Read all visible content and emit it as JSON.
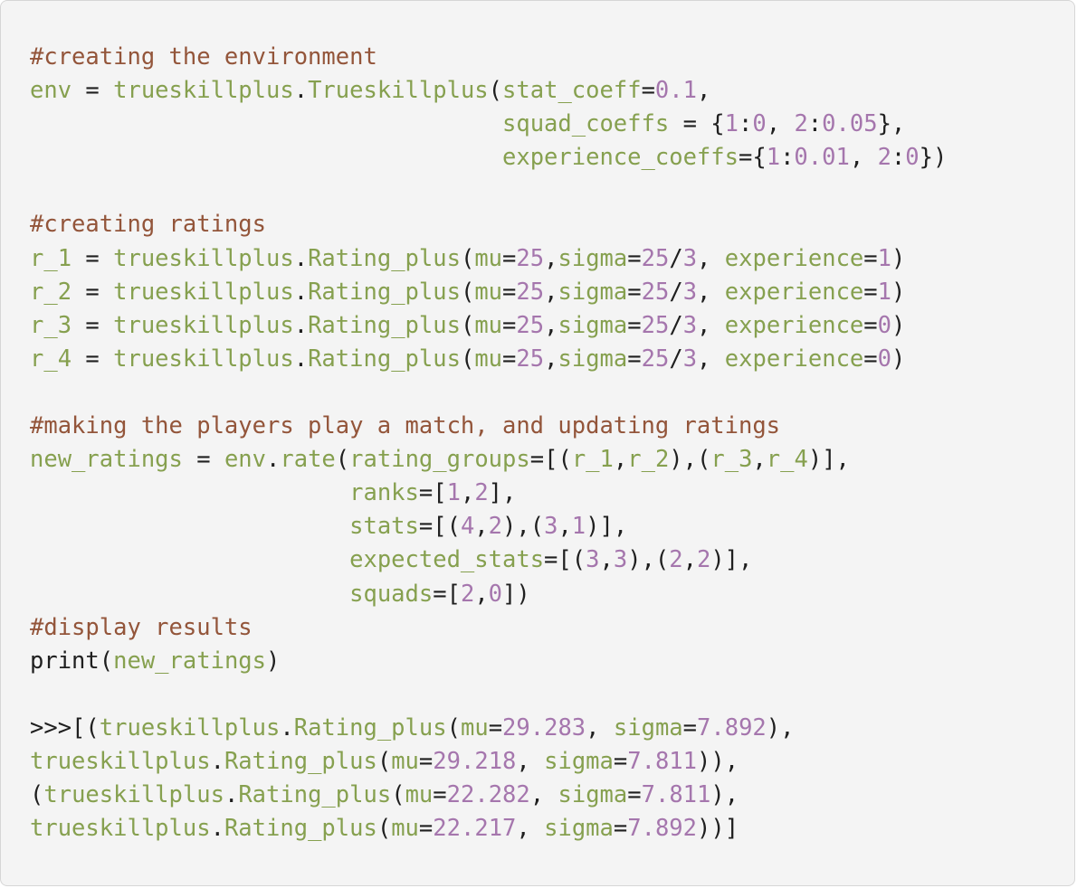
{
  "colors": {
    "background": "#f4f4f4",
    "comment": "#93553a",
    "name": "#86a04f",
    "number": "#a576ad",
    "operator": "#1f1f1f"
  },
  "code_lines": [
    [
      [
        "cmt",
        "#creating the environment"
      ]
    ],
    [
      [
        "nm",
        "env"
      ],
      [
        "op",
        " = "
      ],
      [
        "nm",
        "trueskillplus"
      ],
      [
        "op",
        "."
      ],
      [
        "nm",
        "Trueskillplus"
      ],
      [
        "op",
        "("
      ],
      [
        "nm",
        "stat_coeff"
      ],
      [
        "op",
        "="
      ],
      [
        "num",
        "0.1"
      ],
      [
        "op",
        ","
      ]
    ],
    [
      [
        "op",
        "                                  "
      ],
      [
        "nm",
        "squad_coeffs"
      ],
      [
        "op",
        " = {"
      ],
      [
        "num",
        "1"
      ],
      [
        "op",
        ":"
      ],
      [
        "num",
        "0"
      ],
      [
        "op",
        ", "
      ],
      [
        "num",
        "2"
      ],
      [
        "op",
        ":"
      ],
      [
        "num",
        "0.05"
      ],
      [
        "op",
        "},"
      ]
    ],
    [
      [
        "op",
        "                                  "
      ],
      [
        "nm",
        "experience_coeffs"
      ],
      [
        "op",
        "={"
      ],
      [
        "num",
        "1"
      ],
      [
        "op",
        ":"
      ],
      [
        "num",
        "0.01"
      ],
      [
        "op",
        ", "
      ],
      [
        "num",
        "2"
      ],
      [
        "op",
        ":"
      ],
      [
        "num",
        "0"
      ],
      [
        "op",
        "})"
      ]
    ],
    [],
    [
      [
        "cmt",
        "#creating ratings"
      ]
    ],
    [
      [
        "nm",
        "r_1"
      ],
      [
        "op",
        " = "
      ],
      [
        "nm",
        "trueskillplus"
      ],
      [
        "op",
        "."
      ],
      [
        "nm",
        "Rating_plus"
      ],
      [
        "op",
        "("
      ],
      [
        "nm",
        "mu"
      ],
      [
        "op",
        "="
      ],
      [
        "num",
        "25"
      ],
      [
        "op",
        ","
      ],
      [
        "nm",
        "sigma"
      ],
      [
        "op",
        "="
      ],
      [
        "num",
        "25"
      ],
      [
        "op",
        "/"
      ],
      [
        "num",
        "3"
      ],
      [
        "op",
        ", "
      ],
      [
        "nm",
        "experience"
      ],
      [
        "op",
        "="
      ],
      [
        "num",
        "1"
      ],
      [
        "op",
        ")"
      ]
    ],
    [
      [
        "nm",
        "r_2"
      ],
      [
        "op",
        " = "
      ],
      [
        "nm",
        "trueskillplus"
      ],
      [
        "op",
        "."
      ],
      [
        "nm",
        "Rating_plus"
      ],
      [
        "op",
        "("
      ],
      [
        "nm",
        "mu"
      ],
      [
        "op",
        "="
      ],
      [
        "num",
        "25"
      ],
      [
        "op",
        ","
      ],
      [
        "nm",
        "sigma"
      ],
      [
        "op",
        "="
      ],
      [
        "num",
        "25"
      ],
      [
        "op",
        "/"
      ],
      [
        "num",
        "3"
      ],
      [
        "op",
        ", "
      ],
      [
        "nm",
        "experience"
      ],
      [
        "op",
        "="
      ],
      [
        "num",
        "1"
      ],
      [
        "op",
        ")"
      ]
    ],
    [
      [
        "nm",
        "r_3"
      ],
      [
        "op",
        " = "
      ],
      [
        "nm",
        "trueskillplus"
      ],
      [
        "op",
        "."
      ],
      [
        "nm",
        "Rating_plus"
      ],
      [
        "op",
        "("
      ],
      [
        "nm",
        "mu"
      ],
      [
        "op",
        "="
      ],
      [
        "num",
        "25"
      ],
      [
        "op",
        ","
      ],
      [
        "nm",
        "sigma"
      ],
      [
        "op",
        "="
      ],
      [
        "num",
        "25"
      ],
      [
        "op",
        "/"
      ],
      [
        "num",
        "3"
      ],
      [
        "op",
        ", "
      ],
      [
        "nm",
        "experience"
      ],
      [
        "op",
        "="
      ],
      [
        "num",
        "0"
      ],
      [
        "op",
        ")"
      ]
    ],
    [
      [
        "nm",
        "r_4"
      ],
      [
        "op",
        " = "
      ],
      [
        "nm",
        "trueskillplus"
      ],
      [
        "op",
        "."
      ],
      [
        "nm",
        "Rating_plus"
      ],
      [
        "op",
        "("
      ],
      [
        "nm",
        "mu"
      ],
      [
        "op",
        "="
      ],
      [
        "num",
        "25"
      ],
      [
        "op",
        ","
      ],
      [
        "nm",
        "sigma"
      ],
      [
        "op",
        "="
      ],
      [
        "num",
        "25"
      ],
      [
        "op",
        "/"
      ],
      [
        "num",
        "3"
      ],
      [
        "op",
        ", "
      ],
      [
        "nm",
        "experience"
      ],
      [
        "op",
        "="
      ],
      [
        "num",
        "0"
      ],
      [
        "op",
        ")"
      ]
    ],
    [],
    [
      [
        "cmt",
        "#making the players play a match, and updating ratings"
      ]
    ],
    [
      [
        "nm",
        "new_ratings"
      ],
      [
        "op",
        " = "
      ],
      [
        "nm",
        "env"
      ],
      [
        "op",
        "."
      ],
      [
        "nm",
        "rate"
      ],
      [
        "op",
        "("
      ],
      [
        "nm",
        "rating_groups"
      ],
      [
        "op",
        "=[("
      ],
      [
        "nm",
        "r_1"
      ],
      [
        "op",
        ","
      ],
      [
        "nm",
        "r_2"
      ],
      [
        "op",
        "),("
      ],
      [
        "nm",
        "r_3"
      ],
      [
        "op",
        ","
      ],
      [
        "nm",
        "r_4"
      ],
      [
        "op",
        ")],"
      ]
    ],
    [
      [
        "op",
        "                       "
      ],
      [
        "nm",
        "ranks"
      ],
      [
        "op",
        "=["
      ],
      [
        "num",
        "1"
      ],
      [
        "op",
        ","
      ],
      [
        "num",
        "2"
      ],
      [
        "op",
        "],"
      ]
    ],
    [
      [
        "op",
        "                       "
      ],
      [
        "nm",
        "stats"
      ],
      [
        "op",
        "=[("
      ],
      [
        "num",
        "4"
      ],
      [
        "op",
        ","
      ],
      [
        "num",
        "2"
      ],
      [
        "op",
        "),("
      ],
      [
        "num",
        "3"
      ],
      [
        "op",
        ","
      ],
      [
        "num",
        "1"
      ],
      [
        "op",
        ")],"
      ]
    ],
    [
      [
        "op",
        "                       "
      ],
      [
        "nm",
        "expected_stats"
      ],
      [
        "op",
        "=[("
      ],
      [
        "num",
        "3"
      ],
      [
        "op",
        ","
      ],
      [
        "num",
        "3"
      ],
      [
        "op",
        "),("
      ],
      [
        "num",
        "2"
      ],
      [
        "op",
        ","
      ],
      [
        "num",
        "2"
      ],
      [
        "op",
        ")],"
      ]
    ],
    [
      [
        "op",
        "                       "
      ],
      [
        "nm",
        "squads"
      ],
      [
        "op",
        "=["
      ],
      [
        "num",
        "2"
      ],
      [
        "op",
        ","
      ],
      [
        "num",
        "0"
      ],
      [
        "op",
        "])"
      ]
    ],
    [
      [
        "cmt",
        "#display results"
      ]
    ],
    [
      [
        "op",
        "print("
      ],
      [
        "nm",
        "new_ratings"
      ],
      [
        "op",
        ")"
      ]
    ],
    [],
    [
      [
        "op",
        ">>>[("
      ],
      [
        "nm",
        "trueskillplus"
      ],
      [
        "op",
        "."
      ],
      [
        "nm",
        "Rating_plus"
      ],
      [
        "op",
        "("
      ],
      [
        "nm",
        "mu"
      ],
      [
        "op",
        "="
      ],
      [
        "num",
        "29.283"
      ],
      [
        "op",
        ", "
      ],
      [
        "nm",
        "sigma"
      ],
      [
        "op",
        "="
      ],
      [
        "num",
        "7.892"
      ],
      [
        "op",
        "),"
      ]
    ],
    [
      [
        "nm",
        "trueskillplus"
      ],
      [
        "op",
        "."
      ],
      [
        "nm",
        "Rating_plus"
      ],
      [
        "op",
        "("
      ],
      [
        "nm",
        "mu"
      ],
      [
        "op",
        "="
      ],
      [
        "num",
        "29.218"
      ],
      [
        "op",
        ", "
      ],
      [
        "nm",
        "sigma"
      ],
      [
        "op",
        "="
      ],
      [
        "num",
        "7.811"
      ],
      [
        "op",
        ")),"
      ]
    ],
    [
      [
        "op",
        "("
      ],
      [
        "nm",
        "trueskillplus"
      ],
      [
        "op",
        "."
      ],
      [
        "nm",
        "Rating_plus"
      ],
      [
        "op",
        "("
      ],
      [
        "nm",
        "mu"
      ],
      [
        "op",
        "="
      ],
      [
        "num",
        "22.282"
      ],
      [
        "op",
        ", "
      ],
      [
        "nm",
        "sigma"
      ],
      [
        "op",
        "="
      ],
      [
        "num",
        "7.811"
      ],
      [
        "op",
        "),"
      ]
    ],
    [
      [
        "nm",
        "trueskillplus"
      ],
      [
        "op",
        "."
      ],
      [
        "nm",
        "Rating_plus"
      ],
      [
        "op",
        "("
      ],
      [
        "nm",
        "mu"
      ],
      [
        "op",
        "="
      ],
      [
        "num",
        "22.217"
      ],
      [
        "op",
        ", "
      ],
      [
        "nm",
        "sigma"
      ],
      [
        "op",
        "="
      ],
      [
        "num",
        "7.892"
      ],
      [
        "op",
        "))]"
      ]
    ]
  ]
}
